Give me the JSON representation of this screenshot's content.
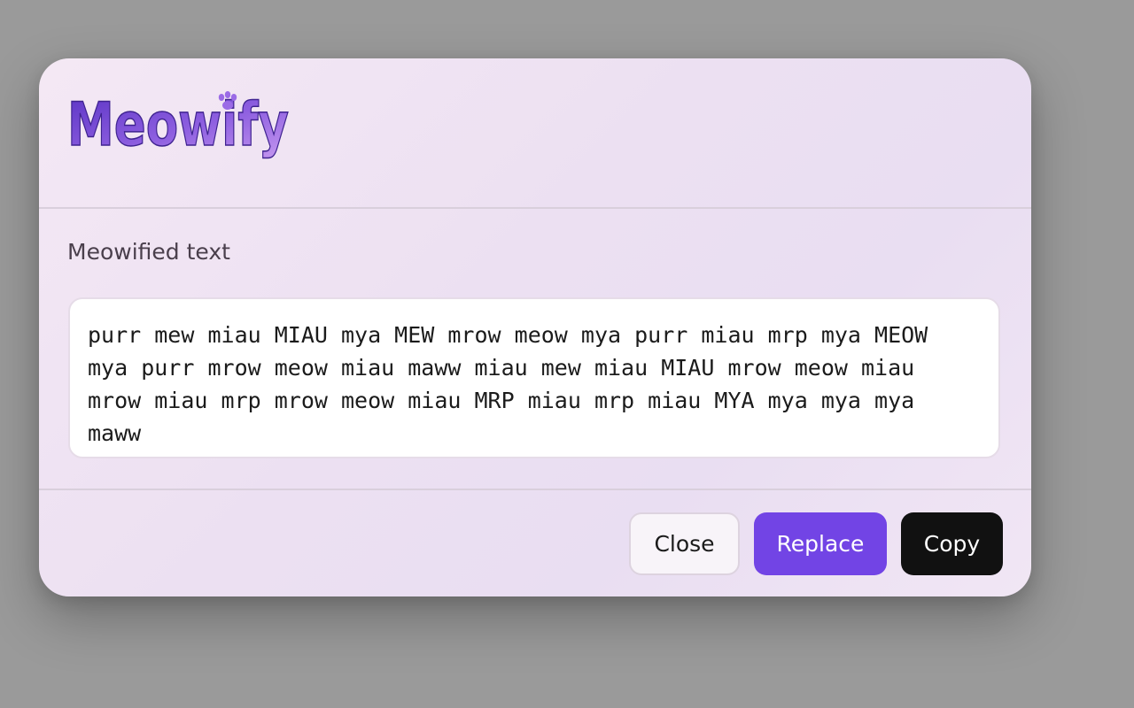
{
  "app": {
    "name": "Meowify"
  },
  "colors": {
    "overlay": "#9a9a9a",
    "logo_dark": "#5a33c4",
    "logo_light": "#c79af0",
    "replace_button": "#7244e5",
    "copy_button": "#111111"
  },
  "section": {
    "label": "Meowified text"
  },
  "output": {
    "text": "purr mew miau MIAU mya MEW mrow meow mya purr miau mrp mya MEOW\nmya purr mrow meow miau maww miau mew miau MIAU mrow meow miau\nmrow miau mrp mrow meow miau MRP miau mrp miau MYA mya mya mya\nmaww"
  },
  "buttons": {
    "close": "Close",
    "replace": "Replace",
    "copy": "Copy"
  },
  "icons": {
    "logo_paw": "paw-icon"
  }
}
